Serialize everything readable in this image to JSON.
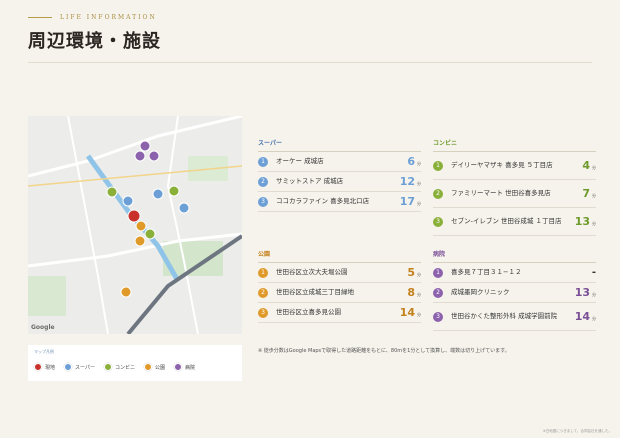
{
  "header": {
    "eyebrow": "LIFE INFORMATION",
    "title": "周辺環境・施設"
  },
  "map": {
    "attribution": "Google"
  },
  "legend": {
    "title": "マップ凡例",
    "items": [
      {
        "marker": "P",
        "label": "現地",
        "color": "#c8322b"
      },
      {
        "marker": "",
        "label": "スーパー",
        "color": "#6b9fd6"
      },
      {
        "marker": "",
        "label": "コンビニ",
        "color": "#8ab03a"
      },
      {
        "marker": "",
        "label": "公園",
        "color": "#e09a2a"
      },
      {
        "marker": "",
        "label": "病院",
        "color": "#8d62ad"
      }
    ]
  },
  "unit": "分",
  "categories": {
    "supermarket": {
      "title": "スーパー",
      "color": "#6b9fd6",
      "items": [
        {
          "num": "1",
          "name": "オーケー 成城店",
          "minutes": "6"
        },
        {
          "num": "2",
          "name": "サミットストア 成城店",
          "minutes": "12"
        },
        {
          "num": "3",
          "name": "ココカラファイン 喜多見北口店",
          "minutes": "17"
        }
      ]
    },
    "conbini": {
      "title": "コンビニ",
      "color": "#8ab03a",
      "items": [
        {
          "num": "1",
          "name": "デイリーヤマザキ 喜多見 ５丁目店",
          "minutes": "4"
        },
        {
          "num": "2",
          "name": "ファミリーマート 世田谷喜多見店",
          "minutes": "7"
        },
        {
          "num": "3",
          "name": "セブン-イレブン 世田谷成城 １丁目店",
          "minutes": "13"
        }
      ]
    },
    "park": {
      "title": "公園",
      "color": "#e09a2a",
      "items": [
        {
          "num": "1",
          "name": "世田谷区立次大夫堀公園",
          "minutes": "5"
        },
        {
          "num": "2",
          "name": "世田谷区立成城三丁目緑地",
          "minutes": "8"
        },
        {
          "num": "3",
          "name": "世田谷区立喜多見公園",
          "minutes": "14"
        }
      ]
    },
    "hospital": {
      "title": "病院",
      "color": "#8d62ad",
      "items": [
        {
          "num": "1",
          "name": "喜多見７丁目３１−１２",
          "minutes": "-"
        },
        {
          "num": "2",
          "name": "成城墨岡クリニック",
          "minutes": "13"
        },
        {
          "num": "3",
          "name": "世田谷かくた整形外科 成城学園前院",
          "minutes": "14"
        }
      ]
    }
  },
  "note": "※ 徒歩分数はGoogle Mapsで取得した道路距離をもとに、80mを1分として換算し、端数は切り上げています。",
  "footer": "※白地図につきまして、合同会社を通した。"
}
